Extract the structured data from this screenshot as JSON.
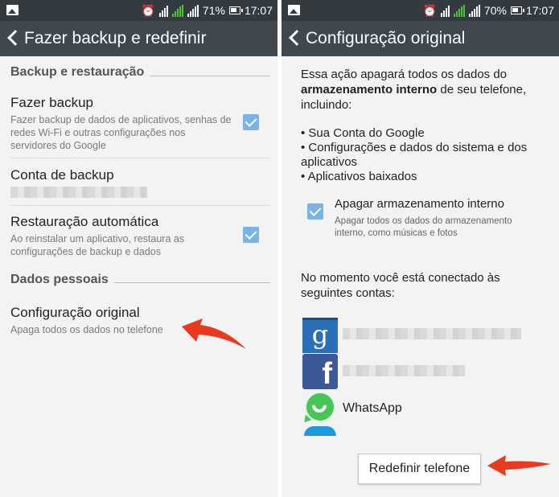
{
  "left": {
    "status": {
      "battery": "71%",
      "time": "17:07"
    },
    "title": "Fazer backup e redefinir",
    "sections": {
      "backup_header": "Backup e restauração",
      "personal_header": "Dados pessoais"
    },
    "items": {
      "backup": {
        "title": "Fazer backup",
        "subtitle": "Fazer backup de dados de aplicativos, senhas de redes Wi-Fi e outras configurações nos servidores do Google",
        "checked": true
      },
      "backup_account": {
        "title": "Conta de backup"
      },
      "auto_restore": {
        "title": "Restauração automática",
        "subtitle": "Ao reinstalar um aplicativo, restaura as configurações de backup e dados",
        "checked": true
      },
      "factory_reset": {
        "title": "Configuração original",
        "subtitle": "Apaga todos os dados no telefone"
      }
    }
  },
  "right": {
    "status": {
      "battery": "70%",
      "time": "17:07"
    },
    "title": "Configuração original",
    "warning": {
      "prefix": "Essa ação apagará todos os dados do ",
      "bold": "armazenamento interno",
      "suffix": " de seu telefone, incluindo:"
    },
    "bullets": [
      "• Sua Conta do Google",
      "• Configurações e dados do sistema e dos aplicativos",
      "• Aplicativos baixados"
    ],
    "erase_option": {
      "title": "Apagar armazenamento interno",
      "subtitle": "Apagar todos os dados do armazenamento interno, como músicas e fotos",
      "checked": true
    },
    "accounts_intro": "No momento você está conectado às seguintes contas:",
    "accounts": {
      "google_icon_glyph": "g",
      "facebook_icon_glyph": "f",
      "whatsapp_label": "WhatsApp"
    },
    "reset_button": "Redefinir telefone"
  },
  "colors": {
    "accent_check": "#7ab3e6",
    "arrow": "#e83a1f",
    "actionbar": "#40474d",
    "statusbar": "#333a40"
  }
}
